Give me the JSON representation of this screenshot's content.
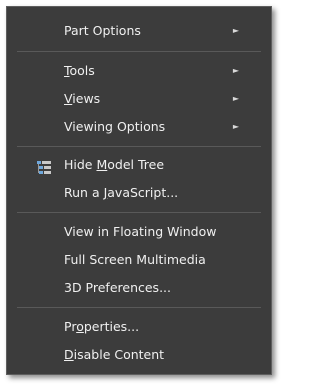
{
  "menu": {
    "items": [
      {
        "id": "part-options",
        "pre": "Part Options",
        "u": "",
        "post": "",
        "submenu": true
      },
      {
        "id": "tools",
        "pre": "",
        "u": "T",
        "post": "ools",
        "submenu": true
      },
      {
        "id": "views",
        "pre": "",
        "u": "V",
        "post": "iews",
        "submenu": true
      },
      {
        "id": "viewing-options",
        "pre": "Viewing Options",
        "u": "",
        "post": "",
        "submenu": true
      },
      {
        "id": "hide-model-tree",
        "pre": "Hide ",
        "u": "M",
        "post": "odel Tree",
        "submenu": false,
        "icon": "model-tree-icon"
      },
      {
        "id": "run-javascript",
        "pre": "Run a ",
        "u": "J",
        "post": "avaScript...",
        "submenu": false
      },
      {
        "id": "view-floating",
        "pre": "View in Floating Window",
        "u": "",
        "post": "",
        "submenu": false
      },
      {
        "id": "full-screen",
        "pre": "Full Screen Multimedia",
        "u": "",
        "post": "",
        "submenu": false
      },
      {
        "id": "3d-preferences",
        "pre": "3D Preferences...",
        "u": "",
        "post": "",
        "submenu": false
      },
      {
        "id": "properties",
        "pre": "Pr",
        "u": "o",
        "post": "perties...",
        "submenu": false
      },
      {
        "id": "disable-content",
        "pre": "",
        "u": "D",
        "post": "isable Content",
        "submenu": false
      }
    ],
    "submenu_arrow": "►",
    "colors": {
      "background": "#3c3c3c",
      "text": "#f0f0f0",
      "separator": "#595959",
      "icon_accent": "#6fa8dc"
    }
  }
}
